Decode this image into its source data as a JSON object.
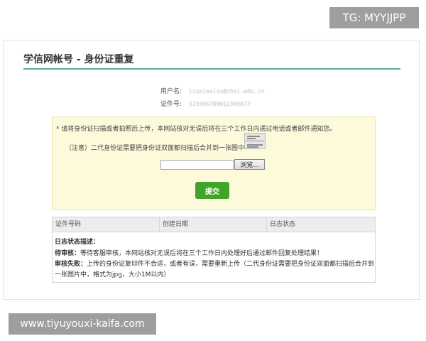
{
  "watermarks": {
    "top": "TG: MYYJJPP",
    "bottom": "www.tiyuyouxi-kaifa.com"
  },
  "header": {
    "title": "学信网帐号 - 身份证重复"
  },
  "account": {
    "username_label": "用户名:",
    "username_value": "liuxiaoliu@chsi.edu.cn",
    "id_label": "证件号:",
    "id_value": "123456789012345677"
  },
  "upload": {
    "instruction": "* 请将身份证扫描或者拍照后上传，本网站核对无误后将在三个工作日内通过电话或者邮件通知您。",
    "note": "（注意）二代身份证需要把身份证双面都扫描后合并到一张图中",
    "file_value": "",
    "browse_label": "浏览...",
    "submit_label": "提交"
  },
  "log_table": {
    "columns": [
      "证件号码",
      "创建日期",
      "日志状态"
    ],
    "desc_title": "日志状态描述：",
    "pending_label": "待审核：",
    "pending_text": "等待客服审核，本网站核对无误后将在三个工作日内处理好后通过邮件回复处理结果！",
    "failed_label": "审核失败：",
    "failed_text_line1": "上传的身份证复印件不合适，或者有误，需要重新上传（二代身份证需要把身份证双面都扫描后合并到",
    "failed_text_line2": "一张图片中，格式为jpg，大小1M以内）"
  }
}
